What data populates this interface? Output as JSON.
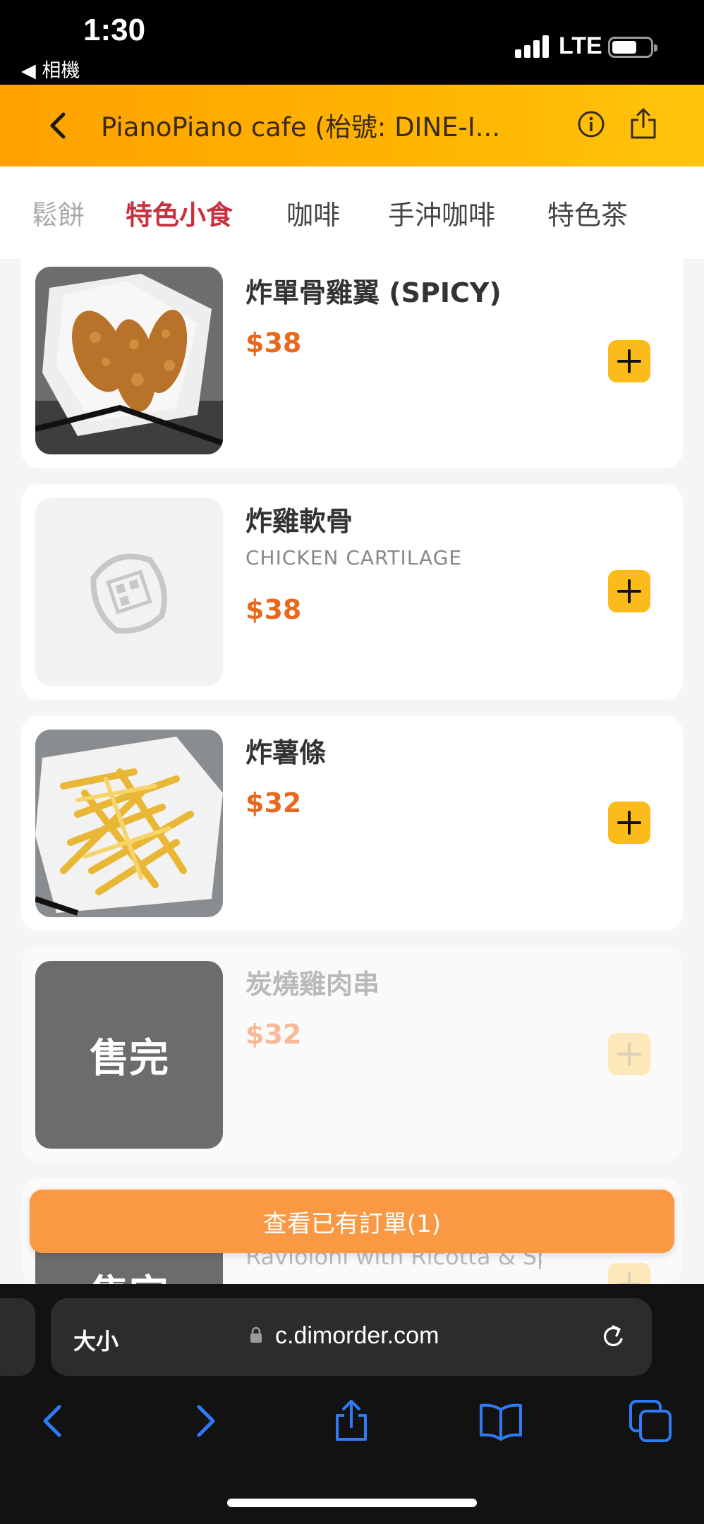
{
  "status_bar": {
    "time": "1:30",
    "back_app": "◀ 相機",
    "network": "LTE"
  },
  "header": {
    "title": "PianoPiano cafe (枱號: DINE-I..."
  },
  "tabs": [
    {
      "label": "鬆餅"
    },
    {
      "label": "特色小食"
    },
    {
      "label": "咖啡"
    },
    {
      "label": "手沖咖啡"
    },
    {
      "label": "特色茶"
    }
  ],
  "active_tab": "特色小食",
  "items": [
    {
      "name": "炸單骨雞翼 (SPICY)",
      "subtitle": "",
      "price": "$38",
      "image": "fried-chicken-wings",
      "sold_out": false
    },
    {
      "name": "炸雞軟骨",
      "subtitle": "CHICKEN CARTILAGE",
      "price": "$38",
      "image": "placeholder-logo",
      "sold_out": false
    },
    {
      "name": "炸薯條",
      "subtitle": "",
      "price": "$32",
      "image": "french-fries",
      "sold_out": false
    },
    {
      "name": "炭燒雞肉串",
      "subtitle": "",
      "price": "$32",
      "image": "placeholder-logo",
      "sold_out": true,
      "sold_out_label": "售完"
    },
    {
      "name": "Ravioloni with Ricotta & Spinach (Cream sauce with",
      "subtitle": "",
      "price": "",
      "image": "placeholder-logo",
      "sold_out": true,
      "sold_out_label": "售完"
    }
  ],
  "order_button": {
    "label": "查看已有訂單(1)"
  },
  "browser": {
    "text_size_label": "大小",
    "url": "c.dimorder.com"
  },
  "colors": {
    "header_gradient_start": "#ffa100",
    "header_gradient_end": "#ffc40c",
    "active_tab": "#c8323f",
    "price": "#e8681e",
    "add_button": "#fbbb1b",
    "order_button": "#fa9844",
    "browser_accent": "#2f7bf5"
  }
}
